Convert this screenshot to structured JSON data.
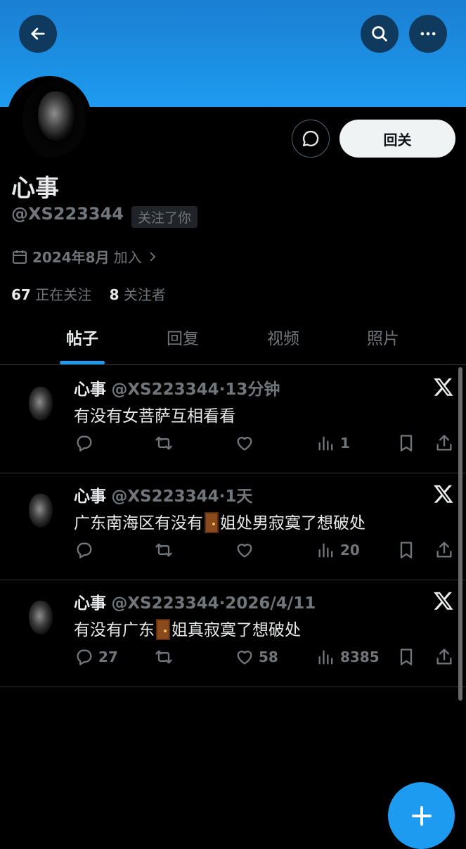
{
  "header": {
    "back_icon": "arrow-left-icon",
    "search_icon": "search-icon",
    "more_icon": "more-horizontal-icon"
  },
  "profile": {
    "name": "心事",
    "handle": "@XS223344",
    "follows_you": "关注了你",
    "joined_date": "2024年8月",
    "joined_suffix": "加入",
    "following_count": "67",
    "following_label": "正在关注",
    "followers_count": "8",
    "followers_label": "关注者",
    "follow_button": "回关"
  },
  "tabs": [
    {
      "label": "帖子",
      "active": true
    },
    {
      "label": "回复",
      "active": false
    },
    {
      "label": "视频",
      "active": false
    },
    {
      "label": "照片",
      "active": false
    }
  ],
  "posts": [
    {
      "name": "心事",
      "handle": "@XS223344",
      "time": "13分钟",
      "text_before": "有没有女菩萨互相看看",
      "text_after": "",
      "has_door": false,
      "replies": "",
      "reposts": "",
      "likes": "",
      "views": "1"
    },
    {
      "name": "心事",
      "handle": "@XS223344",
      "time": "1天",
      "text_before": "广东南海区有没有",
      "text_after": "姐处男寂寞了想破处",
      "has_door": true,
      "replies": "",
      "reposts": "",
      "likes": "",
      "views": "20"
    },
    {
      "name": "心事",
      "handle": "@XS223344",
      "time": "2026/4/11",
      "text_before": "有没有广东",
      "text_after": "姐真寂寞了想破处",
      "has_door": true,
      "replies": "27",
      "reposts": "",
      "likes": "58",
      "views": "8385"
    }
  ],
  "colors": {
    "accent": "#1d9bf0",
    "muted": "#71767b",
    "text": "#e7e9ea",
    "background": "#000000"
  }
}
